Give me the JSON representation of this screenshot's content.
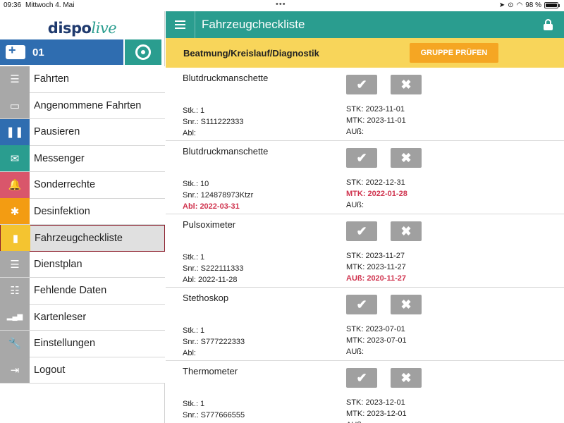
{
  "status": {
    "time": "09:36",
    "date": "Mittwoch 4. Mai",
    "battery": "98 %",
    "battery_level": 0.98
  },
  "logo": {
    "brand": "dispo",
    "suffix": "live"
  },
  "vehicle": {
    "number": "01"
  },
  "menu": [
    {
      "label": "Fahrten",
      "icon": "list-icon",
      "color": "#a8a8a8"
    },
    {
      "label": "Angenommene Fahrten",
      "icon": "id-card-icon",
      "color": "#a8a8a8"
    },
    {
      "label": "Pausieren",
      "icon": "pause-icon",
      "color": "#2f6db0"
    },
    {
      "label": "Messenger",
      "icon": "envelope-icon",
      "color": "#2a9d8f"
    },
    {
      "label": "Sonderrechte",
      "icon": "bell-icon",
      "color": "#d9566b"
    },
    {
      "label": "Desinfektion",
      "icon": "bug-icon",
      "color": "#f39c12"
    },
    {
      "label": "Fahrzeugcheckliste",
      "icon": "book-icon",
      "color": "#f4c430",
      "active": true
    },
    {
      "label": "Dienstplan",
      "icon": "list-icon",
      "color": "#a8a8a8"
    },
    {
      "label": "Fehlende Daten",
      "icon": "database-icon",
      "color": "#a8a8a8"
    },
    {
      "label": "Kartenleser",
      "icon": "signal-bars-icon",
      "color": "#a8a8a8"
    },
    {
      "label": "Einstellungen",
      "icon": "wrench-icon",
      "color": "#a8a8a8"
    },
    {
      "label": "Logout",
      "icon": "logout-icon",
      "color": "#a8a8a8"
    }
  ],
  "header": {
    "title": "Fahrzeugcheckliste"
  },
  "group": {
    "title": "Beatmung/Kreislauf/Diagnostik",
    "button": "GRUPPE PRÜFEN"
  },
  "items": [
    {
      "name": "Blutdruckmanschette",
      "stk": "Stk.: 1",
      "snr": "Snr.: S111222333",
      "abl": "Abl:",
      "abl_warn": false,
      "stk_date": "STK: 2023-11-01",
      "stk_warn": false,
      "mtk": "MTK: 2023-11-01",
      "mtk_warn": false,
      "aub": "AUß:",
      "aub_warn": false
    },
    {
      "name": "Blutdruckmanschette",
      "stk": "Stk.: 10",
      "snr": "Snr.: 124878973Ktzr",
      "abl": "Abl: 2022-03-31",
      "abl_warn": true,
      "stk_date": "STK: 2022-12-31",
      "stk_warn": false,
      "mtk": "MTK: 2022-01-28",
      "mtk_warn": true,
      "aub": "AUß:",
      "aub_warn": false
    },
    {
      "name": "Pulsoximeter",
      "stk": "Stk.: 1",
      "snr": "Snr.: S222111333",
      "abl": "Abl: 2022-11-28",
      "abl_warn": false,
      "stk_date": "STK: 2023-11-27",
      "stk_warn": false,
      "mtk": "MTK: 2023-11-27",
      "mtk_warn": false,
      "aub": "AUß: 2020-11-27",
      "aub_warn": true
    },
    {
      "name": "Stethoskop",
      "stk": "Stk.: 1",
      "snr": "Snr.: S777222333",
      "abl": "Abl:",
      "abl_warn": false,
      "stk_date": "STK: 2023-07-01",
      "stk_warn": false,
      "mtk": "MTK: 2023-07-01",
      "mtk_warn": false,
      "aub": "AUß:",
      "aub_warn": false
    },
    {
      "name": "Thermometer",
      "stk": "Stk.: 1",
      "snr": "Snr.: S777666555",
      "abl": "Abl:",
      "abl_warn": false,
      "stk_date": "STK: 2023-12-01",
      "stk_warn": false,
      "mtk": "MTK: 2023-12-01",
      "mtk_warn": false,
      "aub": "AUß:",
      "aub_warn": false
    }
  ],
  "colors": {
    "accent": "#2a9d8f",
    "vehicle": "#2f6db0",
    "group_bar": "#f8d55a",
    "group_button": "#f5a623",
    "warning": "#d0344f"
  }
}
